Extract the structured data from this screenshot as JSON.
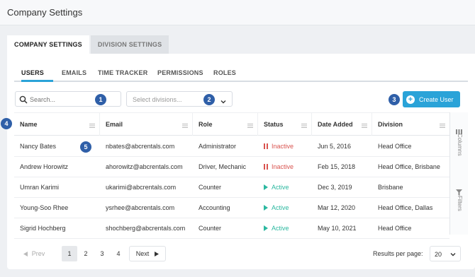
{
  "header": {
    "title": "Company Settings"
  },
  "top_tabs": [
    {
      "label": "COMPANY SETTINGS",
      "active": true
    },
    {
      "label": "DIVISION SETTINGS",
      "active": false
    }
  ],
  "sub_tabs": [
    {
      "label": "USERS",
      "active": true
    },
    {
      "label": "EMAILS",
      "active": false
    },
    {
      "label": "TIME TRACKER",
      "active": false
    },
    {
      "label": "PERMISSIONS",
      "active": false
    },
    {
      "label": "ROLES",
      "active": false
    }
  ],
  "search": {
    "placeholder": "Search..."
  },
  "division_select": {
    "placeholder": "Select divisions..."
  },
  "create_user": {
    "label": "Create User"
  },
  "badges": [
    "1",
    "2",
    "3",
    "4",
    "5"
  ],
  "table": {
    "columns": [
      "Name",
      "Email",
      "Role",
      "Status",
      "Date Added",
      "Division"
    ],
    "rows": [
      {
        "name": "Nancy Bates",
        "email": "nbates@abcrentals.com",
        "role": "Administrator",
        "status": "Inactive",
        "date": "Jun 5, 2016",
        "division": "Head Office"
      },
      {
        "name": "Andrew Horowitz",
        "email": "ahorowitz@abcrentals.com",
        "role": "Driver, Mechanic",
        "status": "Inactive",
        "date": "Feb 15, 2018",
        "division": "Head Office, Brisbane"
      },
      {
        "name": "Umran Karimi",
        "email": "ukarimi@abcrentals.com",
        "role": "Counter",
        "status": "Active",
        "date": "Dec 3, 2019",
        "division": "Brisbane"
      },
      {
        "name": "Young-Soo Rhee",
        "email": "ysrhee@abcrentals.com",
        "role": "Accounting",
        "status": "Active",
        "date": "Mar 12, 2020",
        "division": "Head Office, Dallas"
      },
      {
        "name": "Sigrid Hochberg",
        "email": "shochberg@abcrentals.com",
        "role": "Counter",
        "status": "Active",
        "date": "May 10, 2021",
        "division": "Head Office"
      }
    ]
  },
  "side_panel": {
    "columns_label": "Columns",
    "filters_label": "Filters"
  },
  "pagination": {
    "prev_label": "Prev",
    "pages": [
      "1",
      "2",
      "3",
      "4"
    ],
    "current": "1",
    "next_label": "Next",
    "results_per_page_label": "Results per page:",
    "results_per_page_value": "20"
  },
  "colors": {
    "accent": "#2aa3d8",
    "badge": "#2f5fa8",
    "inactive": "#d9534f",
    "active": "#2bb8a0"
  }
}
